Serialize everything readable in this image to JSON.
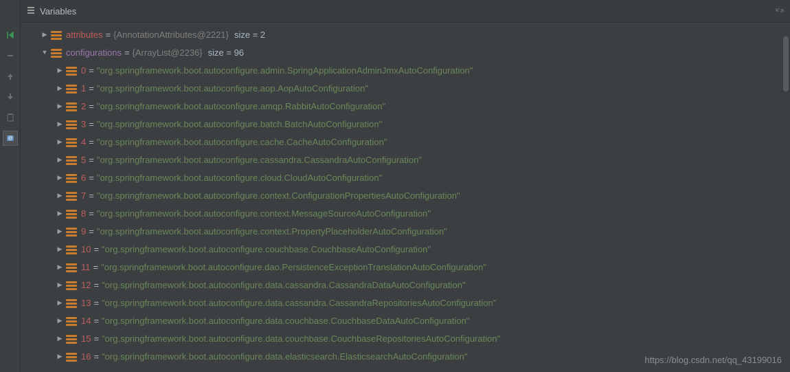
{
  "title": "Variables",
  "attributes_row": {
    "name": "attributes",
    "ref": "{AnnotationAttributes@2221}",
    "size_label": "size = 2"
  },
  "configurations_row": {
    "name": "configurations",
    "ref": "{ArrayList@2236}",
    "size_label": "size = 96"
  },
  "items": [
    {
      "idx": "0",
      "val": "\"org.springframework.boot.autoconfigure.admin.SpringApplicationAdminJmxAutoConfiguration\""
    },
    {
      "idx": "1",
      "val": "\"org.springframework.boot.autoconfigure.aop.AopAutoConfiguration\""
    },
    {
      "idx": "2",
      "val": "\"org.springframework.boot.autoconfigure.amqp.RabbitAutoConfiguration\""
    },
    {
      "idx": "3",
      "val": "\"org.springframework.boot.autoconfigure.batch.BatchAutoConfiguration\""
    },
    {
      "idx": "4",
      "val": "\"org.springframework.boot.autoconfigure.cache.CacheAutoConfiguration\""
    },
    {
      "idx": "5",
      "val": "\"org.springframework.boot.autoconfigure.cassandra.CassandraAutoConfiguration\""
    },
    {
      "idx": "6",
      "val": "\"org.springframework.boot.autoconfigure.cloud.CloudAutoConfiguration\""
    },
    {
      "idx": "7",
      "val": "\"org.springframework.boot.autoconfigure.context.ConfigurationPropertiesAutoConfiguration\""
    },
    {
      "idx": "8",
      "val": "\"org.springframework.boot.autoconfigure.context.MessageSourceAutoConfiguration\""
    },
    {
      "idx": "9",
      "val": "\"org.springframework.boot.autoconfigure.context.PropertyPlaceholderAutoConfiguration\""
    },
    {
      "idx": "10",
      "val": "\"org.springframework.boot.autoconfigure.couchbase.CouchbaseAutoConfiguration\""
    },
    {
      "idx": "11",
      "val": "\"org.springframework.boot.autoconfigure.dao.PersistenceExceptionTranslationAutoConfiguration\""
    },
    {
      "idx": "12",
      "val": "\"org.springframework.boot.autoconfigure.data.cassandra.CassandraDataAutoConfiguration\""
    },
    {
      "idx": "13",
      "val": "\"org.springframework.boot.autoconfigure.data.cassandra.CassandraRepositoriesAutoConfiguration\""
    },
    {
      "idx": "14",
      "val": "\"org.springframework.boot.autoconfigure.data.couchbase.CouchbaseDataAutoConfiguration\""
    },
    {
      "idx": "15",
      "val": "\"org.springframework.boot.autoconfigure.data.couchbase.CouchbaseRepositoriesAutoConfiguration\""
    },
    {
      "idx": "16",
      "val": "\"org.springframework.boot.autoconfigure.data.elasticsearch.ElasticsearchAutoConfiguration\""
    }
  ],
  "watermark": "https://blog.csdn.net/qq_43199016"
}
